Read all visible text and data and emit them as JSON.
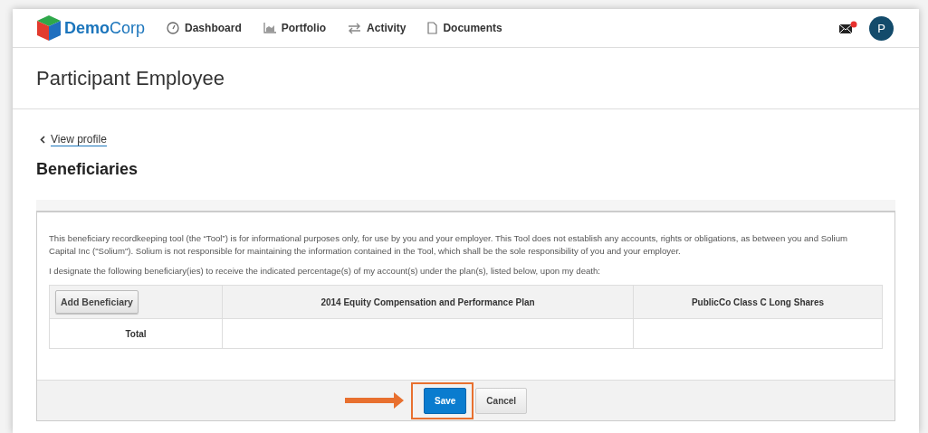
{
  "header": {
    "logo": {
      "bold": "Demo",
      "light": "Corp"
    },
    "nav": [
      {
        "label": "Dashboard",
        "kind": "gauge"
      },
      {
        "label": "Portfolio",
        "kind": "chart"
      },
      {
        "label": "Activity",
        "kind": "arrows"
      },
      {
        "label": "Documents",
        "kind": "doc"
      }
    ],
    "mail": {
      "unread": true
    },
    "avatar": "P"
  },
  "page_title": "Participant Employee",
  "back_link": "View profile",
  "section_title": "Beneficiaries",
  "disclaimer": "This beneficiary recordkeeping tool (the “Tool”) is for informational purposes only, for use by you and your employer. This Tool does not establish any accounts, rights or obligations, as between you and Solium Capital Inc (\"Solium\"). Solium is not responsible for maintaining the information contained in the Tool, which shall be the sole responsibility of you and your employer.",
  "designation": "I designate the following beneficiary(ies) to receive the indicated percentage(s) of my account(s) under the plan(s), listed below, upon my death:",
  "table": {
    "add_button": "Add Beneficiary",
    "columns": [
      "2014 Equity Compensation and Performance Plan",
      "PublicCo Class C Long Shares"
    ],
    "total_label": "Total"
  },
  "buttons": [
    {
      "label": "Save",
      "kind": "primary",
      "highlighted": true
    },
    {
      "label": "Cancel",
      "kind": "secondary",
      "highlighted": false
    }
  ]
}
